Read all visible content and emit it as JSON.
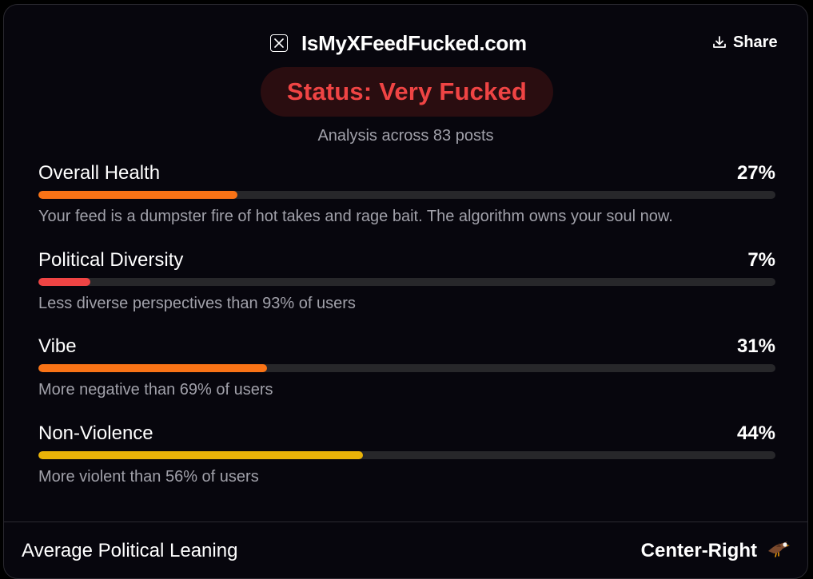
{
  "header": {
    "brand_icon": "x-logo-icon",
    "title": "IsMyXFeedFucked.com",
    "share_label": "Share",
    "share_icon": "download-icon"
  },
  "status": {
    "text": "Status: Very Fucked",
    "color": "#ef4444"
  },
  "analysis": {
    "text": "Analysis across 83 posts"
  },
  "metrics": [
    {
      "label": "Overall Health",
      "value": "27%",
      "fraction": 0.27,
      "color": "#f97316",
      "description": "Your feed is a dumpster fire of hot takes and rage bait. The algorithm owns your soul now."
    },
    {
      "label": "Political Diversity",
      "value": "7%",
      "fraction": 0.07,
      "color": "#ef4444",
      "description": "Less diverse perspectives than 93% of users"
    },
    {
      "label": "Vibe",
      "value": "31%",
      "fraction": 0.31,
      "color": "#f97316",
      "description": "More negative than 69% of users"
    },
    {
      "label": "Non-Violence",
      "value": "44%",
      "fraction": 0.44,
      "color": "#eab308",
      "description": "More violent than 56% of users"
    }
  ],
  "leaning": {
    "label": "Average Political Leaning",
    "value": "Center-Right",
    "icon": "eagle-icon"
  }
}
